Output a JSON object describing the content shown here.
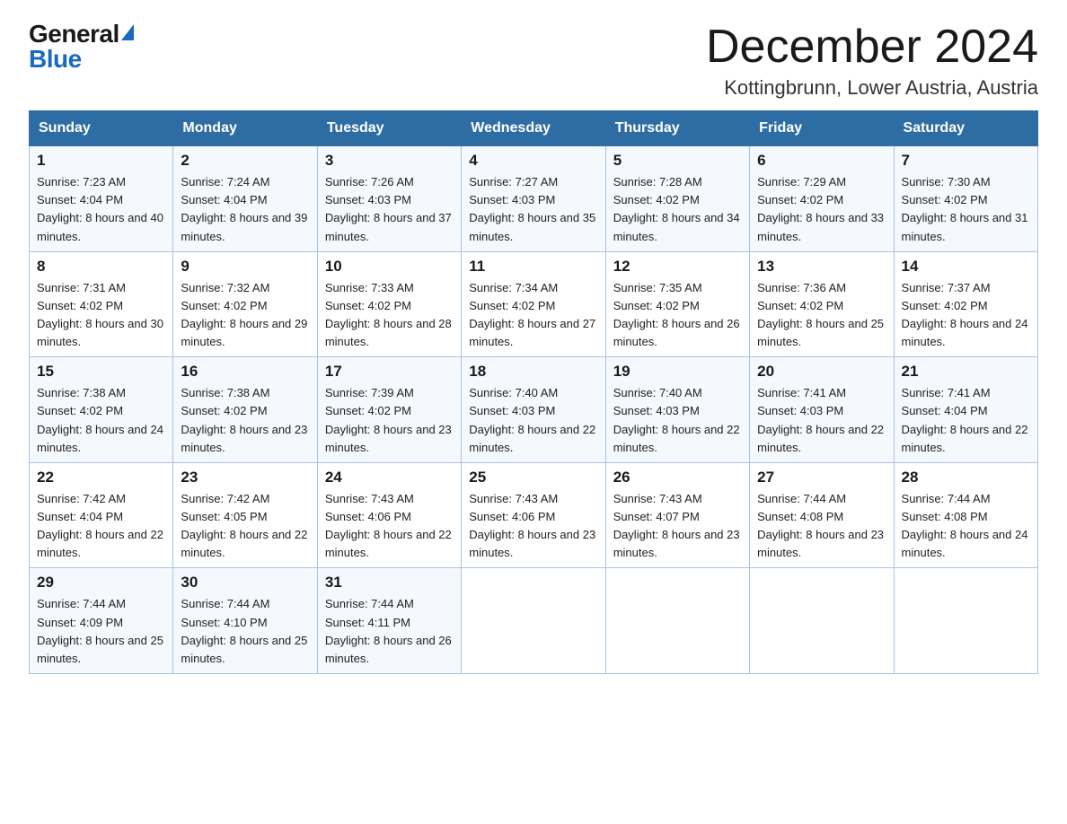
{
  "logo": {
    "general": "General",
    "blue": "Blue"
  },
  "title": "December 2024",
  "subtitle": "Kottingbrunn, Lower Austria, Austria",
  "days_of_week": [
    "Sunday",
    "Monday",
    "Tuesday",
    "Wednesday",
    "Thursday",
    "Friday",
    "Saturday"
  ],
  "weeks": [
    [
      {
        "num": "1",
        "sunrise": "7:23 AM",
        "sunset": "4:04 PM",
        "daylight": "8 hours and 40 minutes."
      },
      {
        "num": "2",
        "sunrise": "7:24 AM",
        "sunset": "4:04 PM",
        "daylight": "8 hours and 39 minutes."
      },
      {
        "num": "3",
        "sunrise": "7:26 AM",
        "sunset": "4:03 PM",
        "daylight": "8 hours and 37 minutes."
      },
      {
        "num": "4",
        "sunrise": "7:27 AM",
        "sunset": "4:03 PM",
        "daylight": "8 hours and 35 minutes."
      },
      {
        "num": "5",
        "sunrise": "7:28 AM",
        "sunset": "4:02 PM",
        "daylight": "8 hours and 34 minutes."
      },
      {
        "num": "6",
        "sunrise": "7:29 AM",
        "sunset": "4:02 PM",
        "daylight": "8 hours and 33 minutes."
      },
      {
        "num": "7",
        "sunrise": "7:30 AM",
        "sunset": "4:02 PM",
        "daylight": "8 hours and 31 minutes."
      }
    ],
    [
      {
        "num": "8",
        "sunrise": "7:31 AM",
        "sunset": "4:02 PM",
        "daylight": "8 hours and 30 minutes."
      },
      {
        "num": "9",
        "sunrise": "7:32 AM",
        "sunset": "4:02 PM",
        "daylight": "8 hours and 29 minutes."
      },
      {
        "num": "10",
        "sunrise": "7:33 AM",
        "sunset": "4:02 PM",
        "daylight": "8 hours and 28 minutes."
      },
      {
        "num": "11",
        "sunrise": "7:34 AM",
        "sunset": "4:02 PM",
        "daylight": "8 hours and 27 minutes."
      },
      {
        "num": "12",
        "sunrise": "7:35 AM",
        "sunset": "4:02 PM",
        "daylight": "8 hours and 26 minutes."
      },
      {
        "num": "13",
        "sunrise": "7:36 AM",
        "sunset": "4:02 PM",
        "daylight": "8 hours and 25 minutes."
      },
      {
        "num": "14",
        "sunrise": "7:37 AM",
        "sunset": "4:02 PM",
        "daylight": "8 hours and 24 minutes."
      }
    ],
    [
      {
        "num": "15",
        "sunrise": "7:38 AM",
        "sunset": "4:02 PM",
        "daylight": "8 hours and 24 minutes."
      },
      {
        "num": "16",
        "sunrise": "7:38 AM",
        "sunset": "4:02 PM",
        "daylight": "8 hours and 23 minutes."
      },
      {
        "num": "17",
        "sunrise": "7:39 AM",
        "sunset": "4:02 PM",
        "daylight": "8 hours and 23 minutes."
      },
      {
        "num": "18",
        "sunrise": "7:40 AM",
        "sunset": "4:03 PM",
        "daylight": "8 hours and 22 minutes."
      },
      {
        "num": "19",
        "sunrise": "7:40 AM",
        "sunset": "4:03 PM",
        "daylight": "8 hours and 22 minutes."
      },
      {
        "num": "20",
        "sunrise": "7:41 AM",
        "sunset": "4:03 PM",
        "daylight": "8 hours and 22 minutes."
      },
      {
        "num": "21",
        "sunrise": "7:41 AM",
        "sunset": "4:04 PM",
        "daylight": "8 hours and 22 minutes."
      }
    ],
    [
      {
        "num": "22",
        "sunrise": "7:42 AM",
        "sunset": "4:04 PM",
        "daylight": "8 hours and 22 minutes."
      },
      {
        "num": "23",
        "sunrise": "7:42 AM",
        "sunset": "4:05 PM",
        "daylight": "8 hours and 22 minutes."
      },
      {
        "num": "24",
        "sunrise": "7:43 AM",
        "sunset": "4:06 PM",
        "daylight": "8 hours and 22 minutes."
      },
      {
        "num": "25",
        "sunrise": "7:43 AM",
        "sunset": "4:06 PM",
        "daylight": "8 hours and 23 minutes."
      },
      {
        "num": "26",
        "sunrise": "7:43 AM",
        "sunset": "4:07 PM",
        "daylight": "8 hours and 23 minutes."
      },
      {
        "num": "27",
        "sunrise": "7:44 AM",
        "sunset": "4:08 PM",
        "daylight": "8 hours and 23 minutes."
      },
      {
        "num": "28",
        "sunrise": "7:44 AM",
        "sunset": "4:08 PM",
        "daylight": "8 hours and 24 minutes."
      }
    ],
    [
      {
        "num": "29",
        "sunrise": "7:44 AM",
        "sunset": "4:09 PM",
        "daylight": "8 hours and 25 minutes."
      },
      {
        "num": "30",
        "sunrise": "7:44 AM",
        "sunset": "4:10 PM",
        "daylight": "8 hours and 25 minutes."
      },
      {
        "num": "31",
        "sunrise": "7:44 AM",
        "sunset": "4:11 PM",
        "daylight": "8 hours and 26 minutes."
      },
      null,
      null,
      null,
      null
    ]
  ]
}
